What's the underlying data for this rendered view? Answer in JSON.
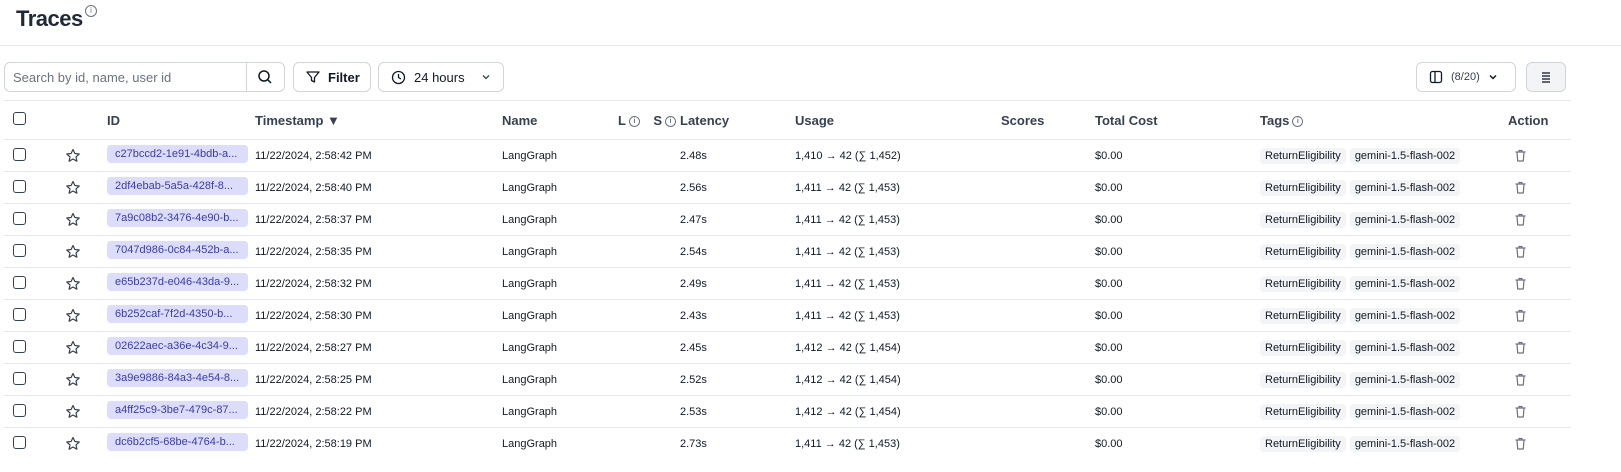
{
  "header": {
    "title": "Traces"
  },
  "toolbar": {
    "search_placeholder": "Search by id, name, user id",
    "filter_label": "Filter",
    "time_range_label": "24 hours",
    "columns_label": "(8/20)"
  },
  "table": {
    "columns": {
      "id": "ID",
      "timestamp": "Timestamp ▼",
      "name": "Name",
      "l": "L",
      "s": "S",
      "latency": "Latency",
      "usage": "Usage",
      "scores": "Scores",
      "total_cost": "Total Cost",
      "tags": "Tags",
      "action": "Action"
    },
    "rows": [
      {
        "id": "c27bccd2-1e91-4bdb-a...",
        "timestamp": "11/22/2024, 2:58:42 PM",
        "name": "LangGraph",
        "latency": "2.48s",
        "usage": "1,410 → 42 (∑ 1,452)",
        "cost": "$0.00",
        "tag1": "ReturnEligibility",
        "tag2": "gemini-1.5-flash-002"
      },
      {
        "id": "2df4ebab-5a5a-428f-8...",
        "timestamp": "11/22/2024, 2:58:40 PM",
        "name": "LangGraph",
        "latency": "2.56s",
        "usage": "1,411 → 42 (∑ 1,453)",
        "cost": "$0.00",
        "tag1": "ReturnEligibility",
        "tag2": "gemini-1.5-flash-002"
      },
      {
        "id": "7a9c08b2-3476-4e90-b...",
        "timestamp": "11/22/2024, 2:58:37 PM",
        "name": "LangGraph",
        "latency": "2.47s",
        "usage": "1,411 → 42 (∑ 1,453)",
        "cost": "$0.00",
        "tag1": "ReturnEligibility",
        "tag2": "gemini-1.5-flash-002"
      },
      {
        "id": "7047d986-0c84-452b-a...",
        "timestamp": "11/22/2024, 2:58:35 PM",
        "name": "LangGraph",
        "latency": "2.54s",
        "usage": "1,411 → 42 (∑ 1,453)",
        "cost": "$0.00",
        "tag1": "ReturnEligibility",
        "tag2": "gemini-1.5-flash-002"
      },
      {
        "id": "e65b237d-e046-43da-9...",
        "timestamp": "11/22/2024, 2:58:32 PM",
        "name": "LangGraph",
        "latency": "2.49s",
        "usage": "1,411 → 42 (∑ 1,453)",
        "cost": "$0.00",
        "tag1": "ReturnEligibility",
        "tag2": "gemini-1.5-flash-002"
      },
      {
        "id": "6b252caf-7f2d-4350-b...",
        "timestamp": "11/22/2024, 2:58:30 PM",
        "name": "LangGraph",
        "latency": "2.43s",
        "usage": "1,411 → 42 (∑ 1,453)",
        "cost": "$0.00",
        "tag1": "ReturnEligibility",
        "tag2": "gemini-1.5-flash-002"
      },
      {
        "id": "02622aec-a36e-4c34-9...",
        "timestamp": "11/22/2024, 2:58:27 PM",
        "name": "LangGraph",
        "latency": "2.45s",
        "usage": "1,412 → 42 (∑ 1,454)",
        "cost": "$0.00",
        "tag1": "ReturnEligibility",
        "tag2": "gemini-1.5-flash-002"
      },
      {
        "id": "3a9e9886-84a3-4e54-8...",
        "timestamp": "11/22/2024, 2:58:25 PM",
        "name": "LangGraph",
        "latency": "2.52s",
        "usage": "1,412 → 42 (∑ 1,454)",
        "cost": "$0.00",
        "tag1": "ReturnEligibility",
        "tag2": "gemini-1.5-flash-002"
      },
      {
        "id": "a4ff25c9-3be7-479c-87...",
        "timestamp": "11/22/2024, 2:58:22 PM",
        "name": "LangGraph",
        "latency": "2.53s",
        "usage": "1,412 → 42 (∑ 1,454)",
        "cost": "$0.00",
        "tag1": "ReturnEligibility",
        "tag2": "gemini-1.5-flash-002"
      },
      {
        "id": "dc6b2cf5-68be-4764-b...",
        "timestamp": "11/22/2024, 2:58:19 PM",
        "name": "LangGraph",
        "latency": "2.73s",
        "usage": "1,411 → 42 (∑ 1,453)",
        "cost": "$0.00",
        "tag1": "ReturnEligibility",
        "tag2": "gemini-1.5-flash-002"
      }
    ]
  }
}
